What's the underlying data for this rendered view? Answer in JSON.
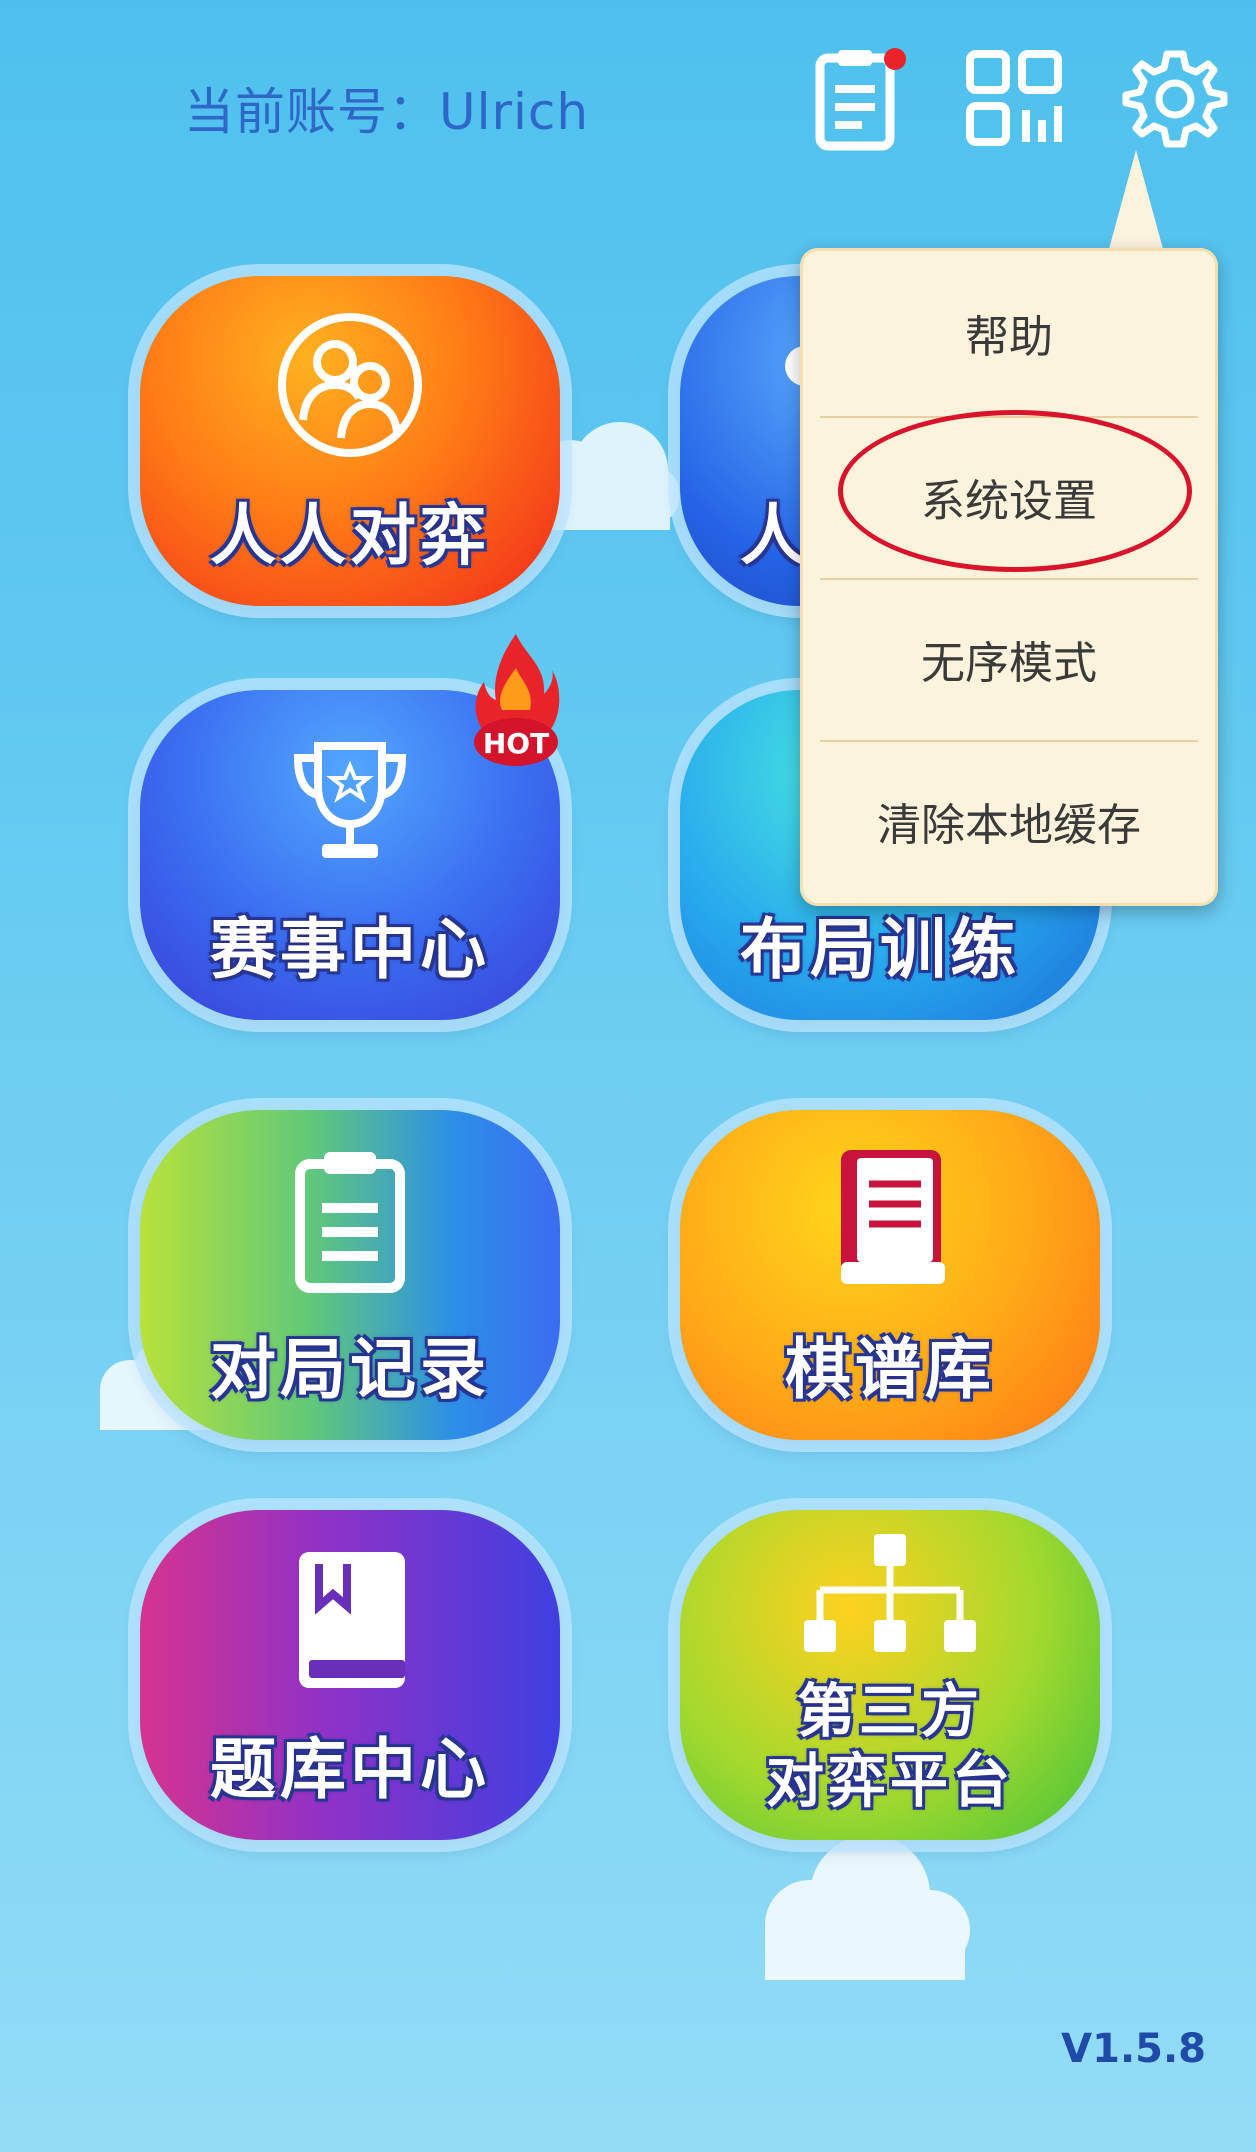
{
  "header": {
    "account_label": "当前账号：Ulrich",
    "icons": [
      "clipboard-icon",
      "qr-code-icon",
      "gear-icon"
    ],
    "notification_dot_color": "#e8232a"
  },
  "tiles": [
    {
      "name": "人人对弈",
      "icon": "two-people-icon",
      "color": "#ff7b16"
    },
    {
      "name": "人",
      "icon": "person-icon",
      "color": "#2563e6"
    },
    {
      "name": "赛事中心",
      "icon": "trophy-icon",
      "color": "#3a6cf0",
      "badge": "HOT"
    },
    {
      "name": "布局训练",
      "icon": "layout-icon",
      "color": "#27a8ee"
    },
    {
      "name": "对局记录",
      "icon": "clipboard-icon",
      "color": "#62c978"
    },
    {
      "name": "棋谱库",
      "icon": "book-icon",
      "color": "#ffac18"
    },
    {
      "name": "题库中心",
      "icon": "bookmark-book-icon",
      "color": "#8e32c8"
    },
    {
      "name_line1": "第三方",
      "name_line2": "对弈平台",
      "icon": "network-icon",
      "color": "#a4d92e"
    }
  ],
  "menu": {
    "items": [
      "帮助",
      "系统设置",
      "无序模式",
      "清除本地缓存"
    ],
    "highlighted": "系统设置",
    "highlight_color": "#d8132a"
  },
  "version": "V1.5.8"
}
